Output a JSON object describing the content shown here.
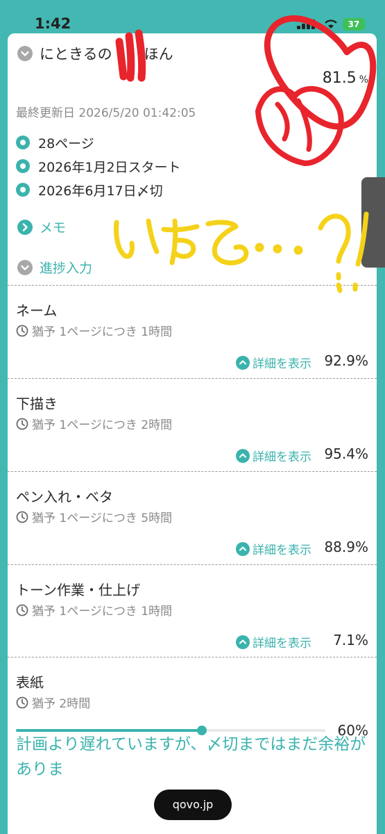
{
  "status": {
    "time": "1:42",
    "battery": "37"
  },
  "header": {
    "title": "にときるの",
    "title_tail": "ほん",
    "total_percent": "81.5",
    "percent_unit": "%",
    "last_updated": "最終更新日 2026/5/20 01:42:05"
  },
  "info": {
    "pages": "28ページ",
    "start": "2026年1月2日スタート",
    "deadline": "2026年6月17日〆切"
  },
  "links": {
    "memo": "メモ",
    "progress_input": "進捗入力"
  },
  "tasks": [
    {
      "name": "ネーム",
      "rate": "猶予 1ページにつき 1時間",
      "detail": "詳細を表示",
      "percent": "92.9%"
    },
    {
      "name": "下描き",
      "rate": "猶予 1ページにつき 2時間",
      "detail": "詳細を表示",
      "percent": "95.4%"
    },
    {
      "name": "ペン入れ・ベタ",
      "rate": "猶予 1ページにつき 5時間",
      "detail": "詳細を表示",
      "percent": "88.9%"
    },
    {
      "name": "トーン作業・仕上げ",
      "rate": "猶予 1ページにつき 1時間",
      "detail": "詳細を表示",
      "percent": "7.1%"
    }
  ],
  "cover": {
    "name": "表紙",
    "rate": "猶予 2時間",
    "progress": 0.6,
    "percent": "60%"
  },
  "message": "計画より遅れていますが、〆切まではまだ余裕がありま",
  "url_pill": "qovo.jp",
  "handwriting": "いける…?!",
  "colors": {
    "accent": "#3bb3ad",
    "background": "#43b8b2",
    "ink_red": "#e8242c",
    "ink_yellow": "#f5d21a"
  }
}
